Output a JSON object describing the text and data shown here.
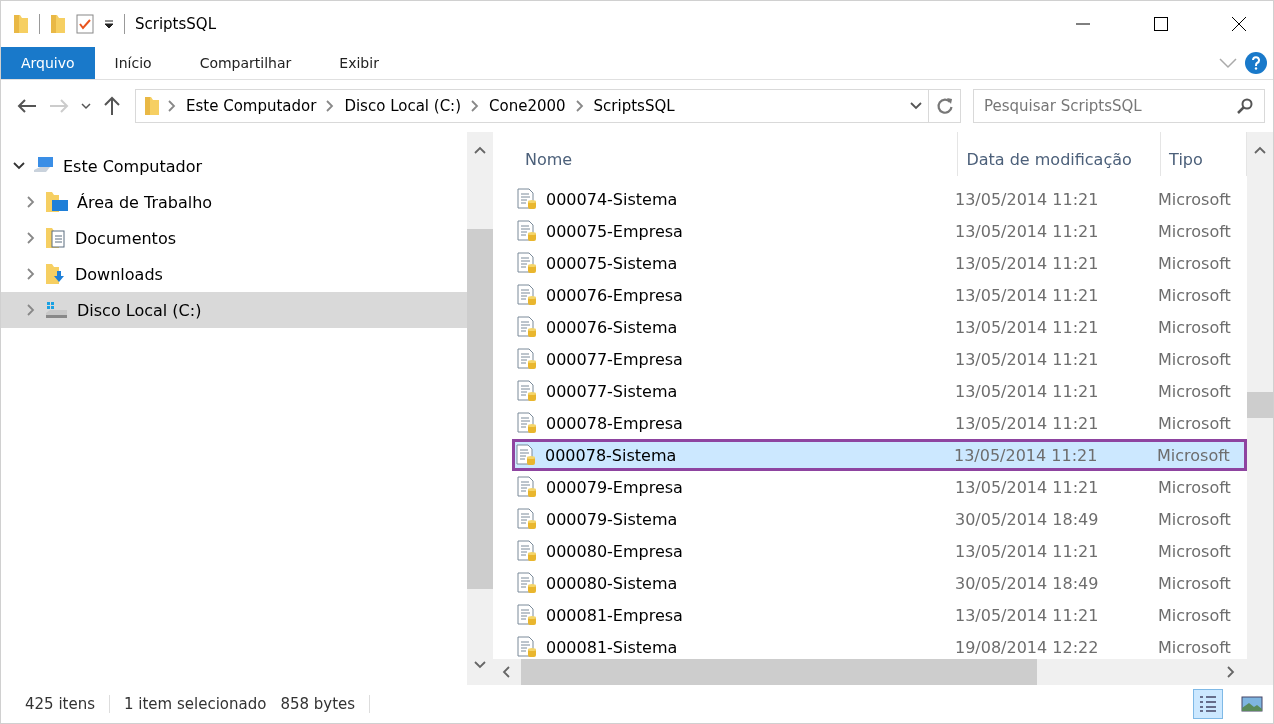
{
  "window": {
    "title": "ScriptsSQL"
  },
  "ribbon_tabs": [
    {
      "label": "Arquivo",
      "selected": true
    },
    {
      "label": "Início",
      "selected": false
    },
    {
      "label": "Compartilhar",
      "selected": false
    },
    {
      "label": "Exibir",
      "selected": false
    }
  ],
  "address": {
    "crumbs": [
      "Este Computador",
      "Disco Local (C:)",
      "Cone2000",
      "ScriptsSQL"
    ]
  },
  "search": {
    "placeholder": "Pesquisar ScriptsSQL"
  },
  "sidebar": {
    "items": [
      {
        "label": "Este Computador",
        "kind": "computer",
        "expanded": true,
        "selected": false,
        "children": [
          {
            "label": "Área de Trabalho",
            "kind": "desktop",
            "expanded": false,
            "selected": false
          },
          {
            "label": "Documentos",
            "kind": "documents",
            "expanded": false,
            "selected": false
          },
          {
            "label": "Downloads",
            "kind": "downloads",
            "expanded": false,
            "selected": false
          },
          {
            "label": "Disco Local (C:)",
            "kind": "drive",
            "expanded": false,
            "selected": true
          }
        ]
      }
    ]
  },
  "table": {
    "columns": [
      "Nome",
      "Data de modificação",
      "Tipo"
    ],
    "rows": [
      {
        "name": "000074-Sistema",
        "date": "13/05/2014 11:21",
        "type": "Microsoft",
        "selected": false
      },
      {
        "name": "000075-Empresa",
        "date": "13/05/2014 11:21",
        "type": "Microsoft",
        "selected": false
      },
      {
        "name": "000075-Sistema",
        "date": "13/05/2014 11:21",
        "type": "Microsoft",
        "selected": false
      },
      {
        "name": "000076-Empresa",
        "date": "13/05/2014 11:21",
        "type": "Microsoft",
        "selected": false
      },
      {
        "name": "000076-Sistema",
        "date": "13/05/2014 11:21",
        "type": "Microsoft",
        "selected": false
      },
      {
        "name": "000077-Empresa",
        "date": "13/05/2014 11:21",
        "type": "Microsoft",
        "selected": false
      },
      {
        "name": "000077-Sistema",
        "date": "13/05/2014 11:21",
        "type": "Microsoft",
        "selected": false
      },
      {
        "name": "000078-Empresa",
        "date": "13/05/2014 11:21",
        "type": "Microsoft",
        "selected": false
      },
      {
        "name": "000078-Sistema",
        "date": "13/05/2014 11:21",
        "type": "Microsoft",
        "selected": true
      },
      {
        "name": "000079-Empresa",
        "date": "13/05/2014 11:21",
        "type": "Microsoft",
        "selected": false
      },
      {
        "name": "000079-Sistema",
        "date": "30/05/2014 18:49",
        "type": "Microsoft",
        "selected": false
      },
      {
        "name": "000080-Empresa",
        "date": "13/05/2014 11:21",
        "type": "Microsoft",
        "selected": false
      },
      {
        "name": "000080-Sistema",
        "date": "30/05/2014 18:49",
        "type": "Microsoft",
        "selected": false
      },
      {
        "name": "000081-Empresa",
        "date": "13/05/2014 11:21",
        "type": "Microsoft",
        "selected": false
      },
      {
        "name": "000081-Sistema",
        "date": "19/08/2014 12:22",
        "type": "Microsoft",
        "selected": false
      }
    ]
  },
  "status_bar": {
    "count": "425 itens",
    "selection": "1 item selecionado",
    "size": "858 bytes"
  }
}
